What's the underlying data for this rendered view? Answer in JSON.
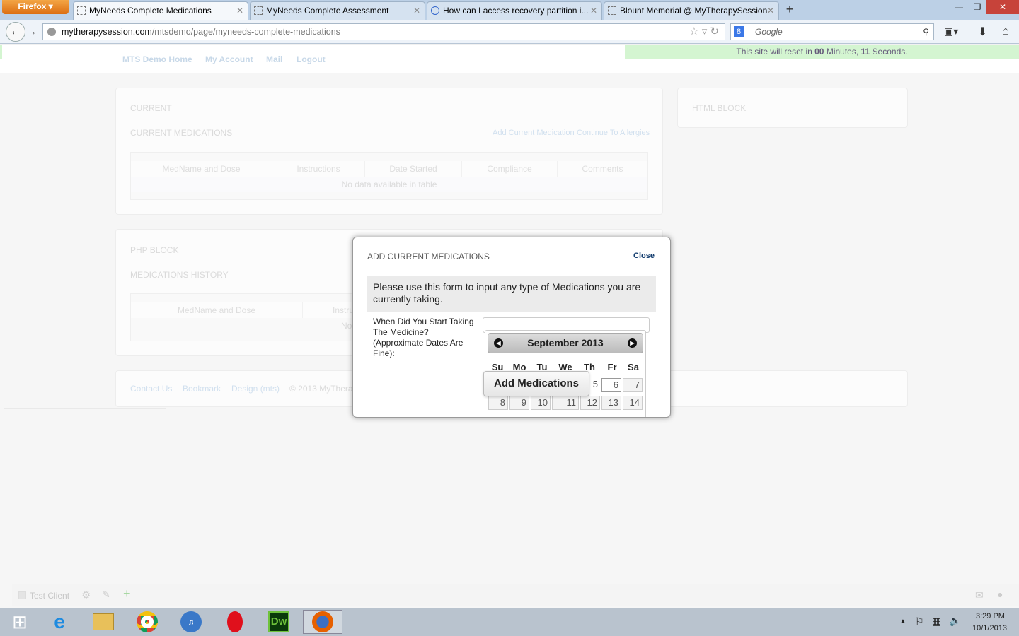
{
  "browser": {
    "firefox_button": "Firefox ▾",
    "tabs": [
      {
        "title": "MyNeeds Complete Medications",
        "active": true
      },
      {
        "title": "MyNeeds Complete Assessment"
      },
      {
        "title": "How can I access recovery partition i..."
      },
      {
        "title": "Blount Memorial @ MyTherapySession"
      }
    ],
    "url_domain": "mytherapysession.com",
    "url_path": "/mtsdemo/page/myneeds-complete-medications",
    "search_placeholder": "Google"
  },
  "reset_banner": {
    "prefix": "This site will reset in ",
    "minutes": "00",
    "mid": " Minutes, ",
    "seconds": "11",
    "suffix": " Seconds."
  },
  "topnav": [
    "MTS Demo Home",
    "My Account",
    "Mail",
    "Logout"
  ],
  "current_panel": {
    "heading": "CURRENT",
    "subheading": "CURRENT MEDICATIONS",
    "links": [
      "Add Current Medication",
      "Continue To Allergies"
    ],
    "columns": [
      "MedName and Dose",
      "Instructions",
      "Date Started",
      "Compliance",
      "Comments"
    ],
    "empty": "No data available in table"
  },
  "html_block": {
    "heading": "HTML BLOCK"
  },
  "php_panel": {
    "heading": "PHP BLOCK",
    "subheading": "MEDICATIONS HISTORY",
    "columns": [
      "MedName and Dose",
      "Instru"
    ],
    "empty": "No"
  },
  "footer": {
    "links": [
      "Contact Us",
      "Bookmark",
      "Design (mts)"
    ],
    "copyright": "© 2013 MyThera"
  },
  "modal": {
    "title": "ADD CURRENT MEDICATIONS",
    "close": "Close",
    "intro": "Please use this form to input any type of Medications you are currently taking.",
    "question": "When Did You Start Taking The Medicine? (Approximate Dates Are Fine):",
    "date_value": "",
    "calendar": {
      "month": "September 2013",
      "dow": [
        "Su",
        "Mo",
        "Tu",
        "We",
        "Th",
        "Fr",
        "Sa"
      ],
      "row1": [
        "5",
        "6",
        "7"
      ],
      "row2": [
        "8",
        "9",
        "10",
        "11",
        "12",
        "13",
        "14"
      ]
    },
    "submit": "Add Medications"
  },
  "bottom_bar": {
    "client": "Test Client"
  },
  "taskbar": {
    "time": "3:29 PM",
    "date": "10/1/2013"
  }
}
